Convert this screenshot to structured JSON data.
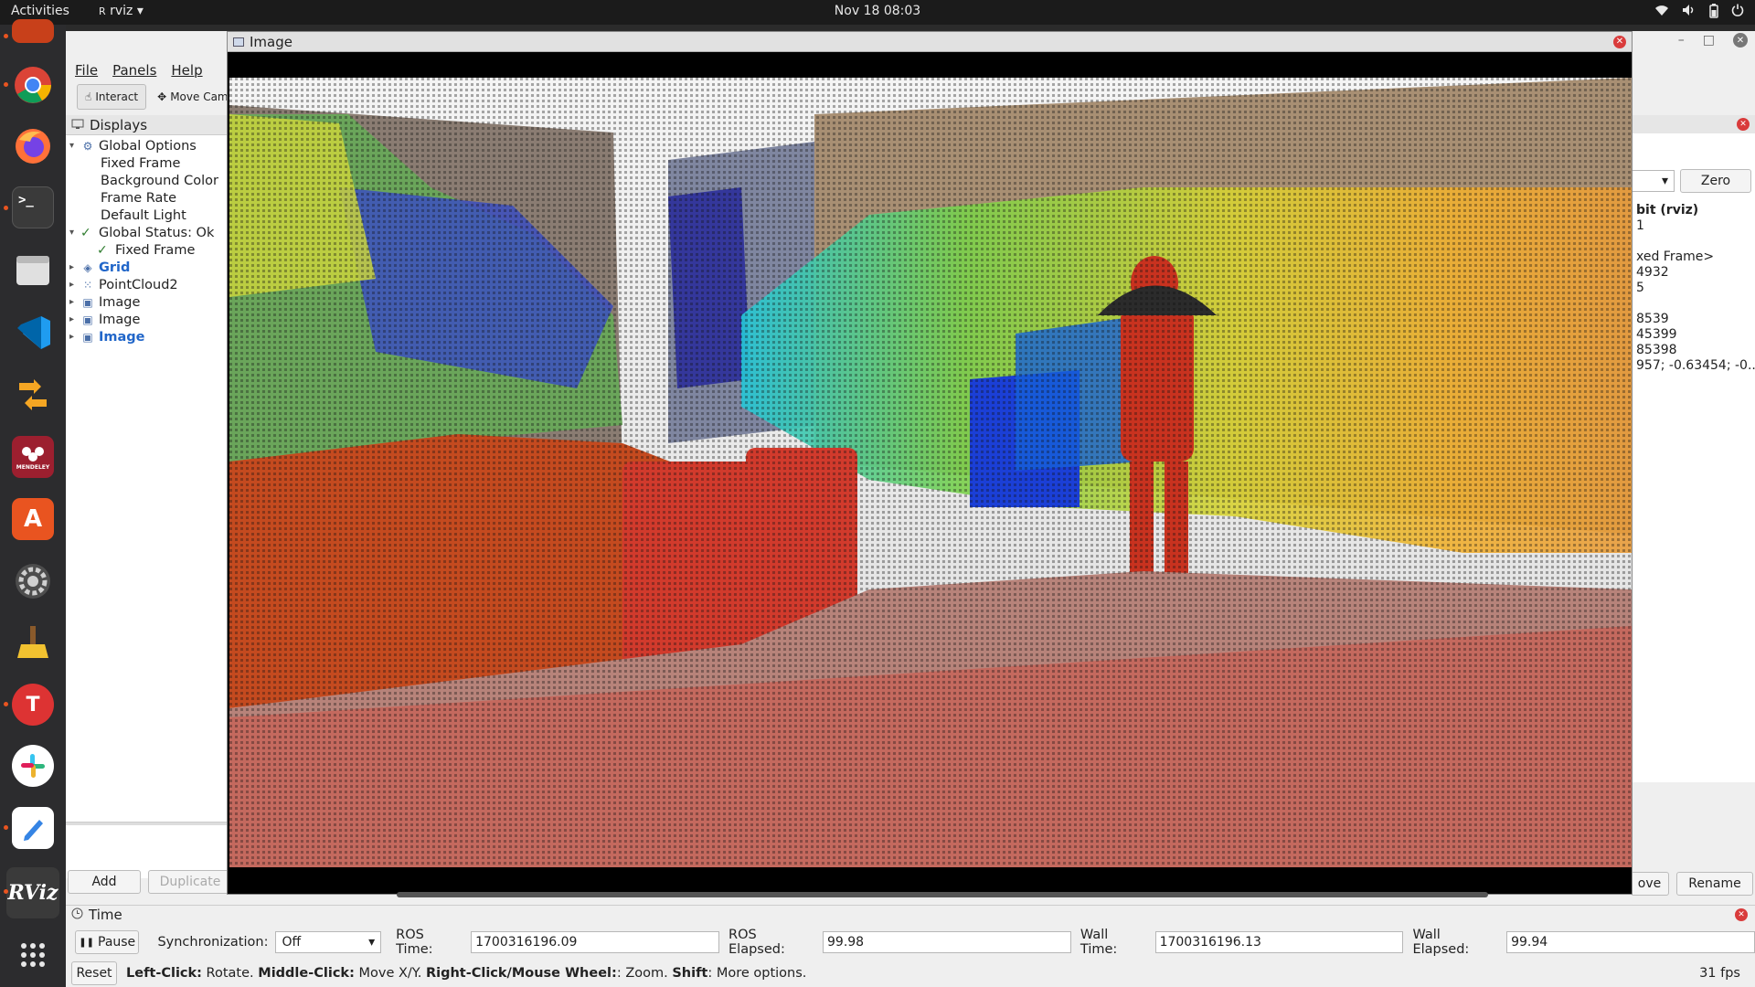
{
  "topbar": {
    "activities": "Activities",
    "app_name": "rviz",
    "clock": "Nov 18  08:03",
    "tray_icons": [
      "wifi-icon",
      "volume-icon",
      "battery-icon",
      "power-icon"
    ]
  },
  "dock": {
    "apps": [
      "ubuntu-software-icon",
      "chrome-icon",
      "firefox-icon",
      "terminal-icon",
      "files-icon",
      "vscode-icon",
      "yed-icon",
      "mendeley-icon",
      "app-center-icon",
      "settings-icon",
      "bleachbit-icon",
      "todesk-icon",
      "slack-icon",
      "text-editor-icon",
      "rviz-icon",
      "show-apps-icon"
    ],
    "mendeley_label": "MENDELEY",
    "rviz_label": "RViz"
  },
  "rviz": {
    "menu": [
      "File",
      "Panels",
      "Help"
    ],
    "toolbar": {
      "interact": "Interact",
      "move_camera": "Move Cam"
    },
    "displays": {
      "title": "Displays",
      "rows": [
        {
          "label": "Global Options",
          "indent": 0,
          "arrow": "▾",
          "icon": "gear-icon"
        },
        {
          "label": "Fixed Frame",
          "indent": 1
        },
        {
          "label": "Background Color",
          "indent": 1
        },
        {
          "label": "Frame Rate",
          "indent": 1
        },
        {
          "label": "Default Light",
          "indent": 1
        },
        {
          "label": "Global Status: Ok",
          "indent": 0,
          "arrow": "▾",
          "check": true
        },
        {
          "label": "Fixed Frame",
          "indent": 1,
          "check": true
        },
        {
          "label": "Grid",
          "indent": 0,
          "arrow": "▸",
          "icon": "grid-icon",
          "highlight": true
        },
        {
          "label": "PointCloud2",
          "indent": 0,
          "arrow": "▸",
          "icon": "pointcloud-icon"
        },
        {
          "label": "Image",
          "indent": 0,
          "arrow": "▸",
          "icon": "image-icon"
        },
        {
          "label": "Image",
          "indent": 0,
          "arrow": "▸",
          "icon": "image-icon"
        },
        {
          "label": "Image",
          "indent": 0,
          "arrow": "▸",
          "icon": "image-icon",
          "highlight": true
        }
      ],
      "add": "Add",
      "duplicate": "Duplicate"
    },
    "right_panel": {
      "zero": "Zero",
      "lines": [
        "bit (rviz)",
        "1",
        "",
        "xed Frame>",
        "4932",
        "5",
        "",
        "8539",
        "45399",
        "85398",
        "957; -0.63454; -0...."
      ],
      "remove": "ove",
      "rename": "Rename"
    },
    "time": {
      "title": "Time",
      "pause": "Pause",
      "sync_label": "Synchronization:",
      "sync_value": "Off",
      "ros_time_label": "ROS Time:",
      "ros_time": "1700316196.09",
      "ros_elapsed_label": "ROS Elapsed:",
      "ros_elapsed": "99.98",
      "wall_time_label": "Wall Time:",
      "wall_time": "1700316196.13",
      "wall_elapsed_label": "Wall Elapsed:",
      "wall_elapsed": "99.94"
    },
    "status": {
      "reset": "Reset",
      "left_click": "Left-Click:",
      "left_click_desc": " Rotate. ",
      "middle_click": "Middle-Click:",
      "middle_click_desc": " Move X/Y. ",
      "right_click": "Right-Click/Mouse Wheel:",
      "right_click_desc": ": Zoom. ",
      "shift": "Shift",
      "shift_desc": ": More options.",
      "fps": "31 fps"
    }
  },
  "image_window": {
    "title": "Image"
  }
}
